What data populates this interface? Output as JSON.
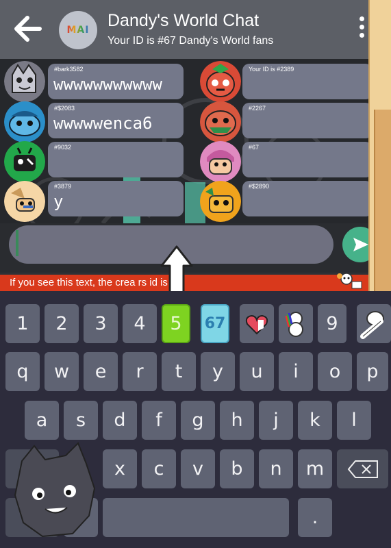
{
  "header": {
    "logo_text": "MAI",
    "title": "Dandy's World Chat",
    "subtitle": "Your ID is #67 Dandy's World fans"
  },
  "messages_left": [
    {
      "uid": "#bark3582",
      "text": "wwwwwwwwwww",
      "avatar_color": "#c9c9d3"
    },
    {
      "uid": "#$2083",
      "text": "wwwwwenca6",
      "avatar_color": "#2b8fc9"
    },
    {
      "uid": "#9032",
      "text": "",
      "avatar_color": "#22a84a"
    },
    {
      "uid": "#3879",
      "text": "y",
      "avatar_color": "#f5d6a6"
    }
  ],
  "messages_right": [
    {
      "uid": "Your ID is #2389",
      "text": "",
      "avatar_color": "#d94a36"
    },
    {
      "uid": "#2267",
      "text": "",
      "avatar_color": "#d7563e"
    },
    {
      "uid": "#67",
      "text": "",
      "avatar_color": "#e08ac0"
    },
    {
      "uid": "#$2890",
      "text": "",
      "avatar_color": "#f0a31c"
    }
  ],
  "input": {
    "value": ""
  },
  "banner": {
    "text": "If you see this text, the crea   rs id is #1."
  },
  "keyboard": {
    "row_numbers": [
      "1",
      "2",
      "3",
      "4",
      "5",
      "67",
      "",
      "",
      "9",
      ""
    ],
    "row_top": [
      "q",
      "w",
      "e",
      "r",
      "t",
      "y",
      "u",
      "i",
      "o",
      "p"
    ],
    "row_mid": [
      "a",
      "s",
      "d",
      "f",
      "g",
      "h",
      "j",
      "k",
      "l"
    ],
    "row_bot": [
      "x",
      "c",
      "v",
      "b",
      "n",
      "m"
    ],
    "row_space": {
      "comma": ",",
      "period": "."
    }
  },
  "colors": {
    "header": "#5c5f66",
    "bubble": "#74788a",
    "send": "#46b28a",
    "banner": "#d9391c",
    "key": "#5f6373"
  }
}
